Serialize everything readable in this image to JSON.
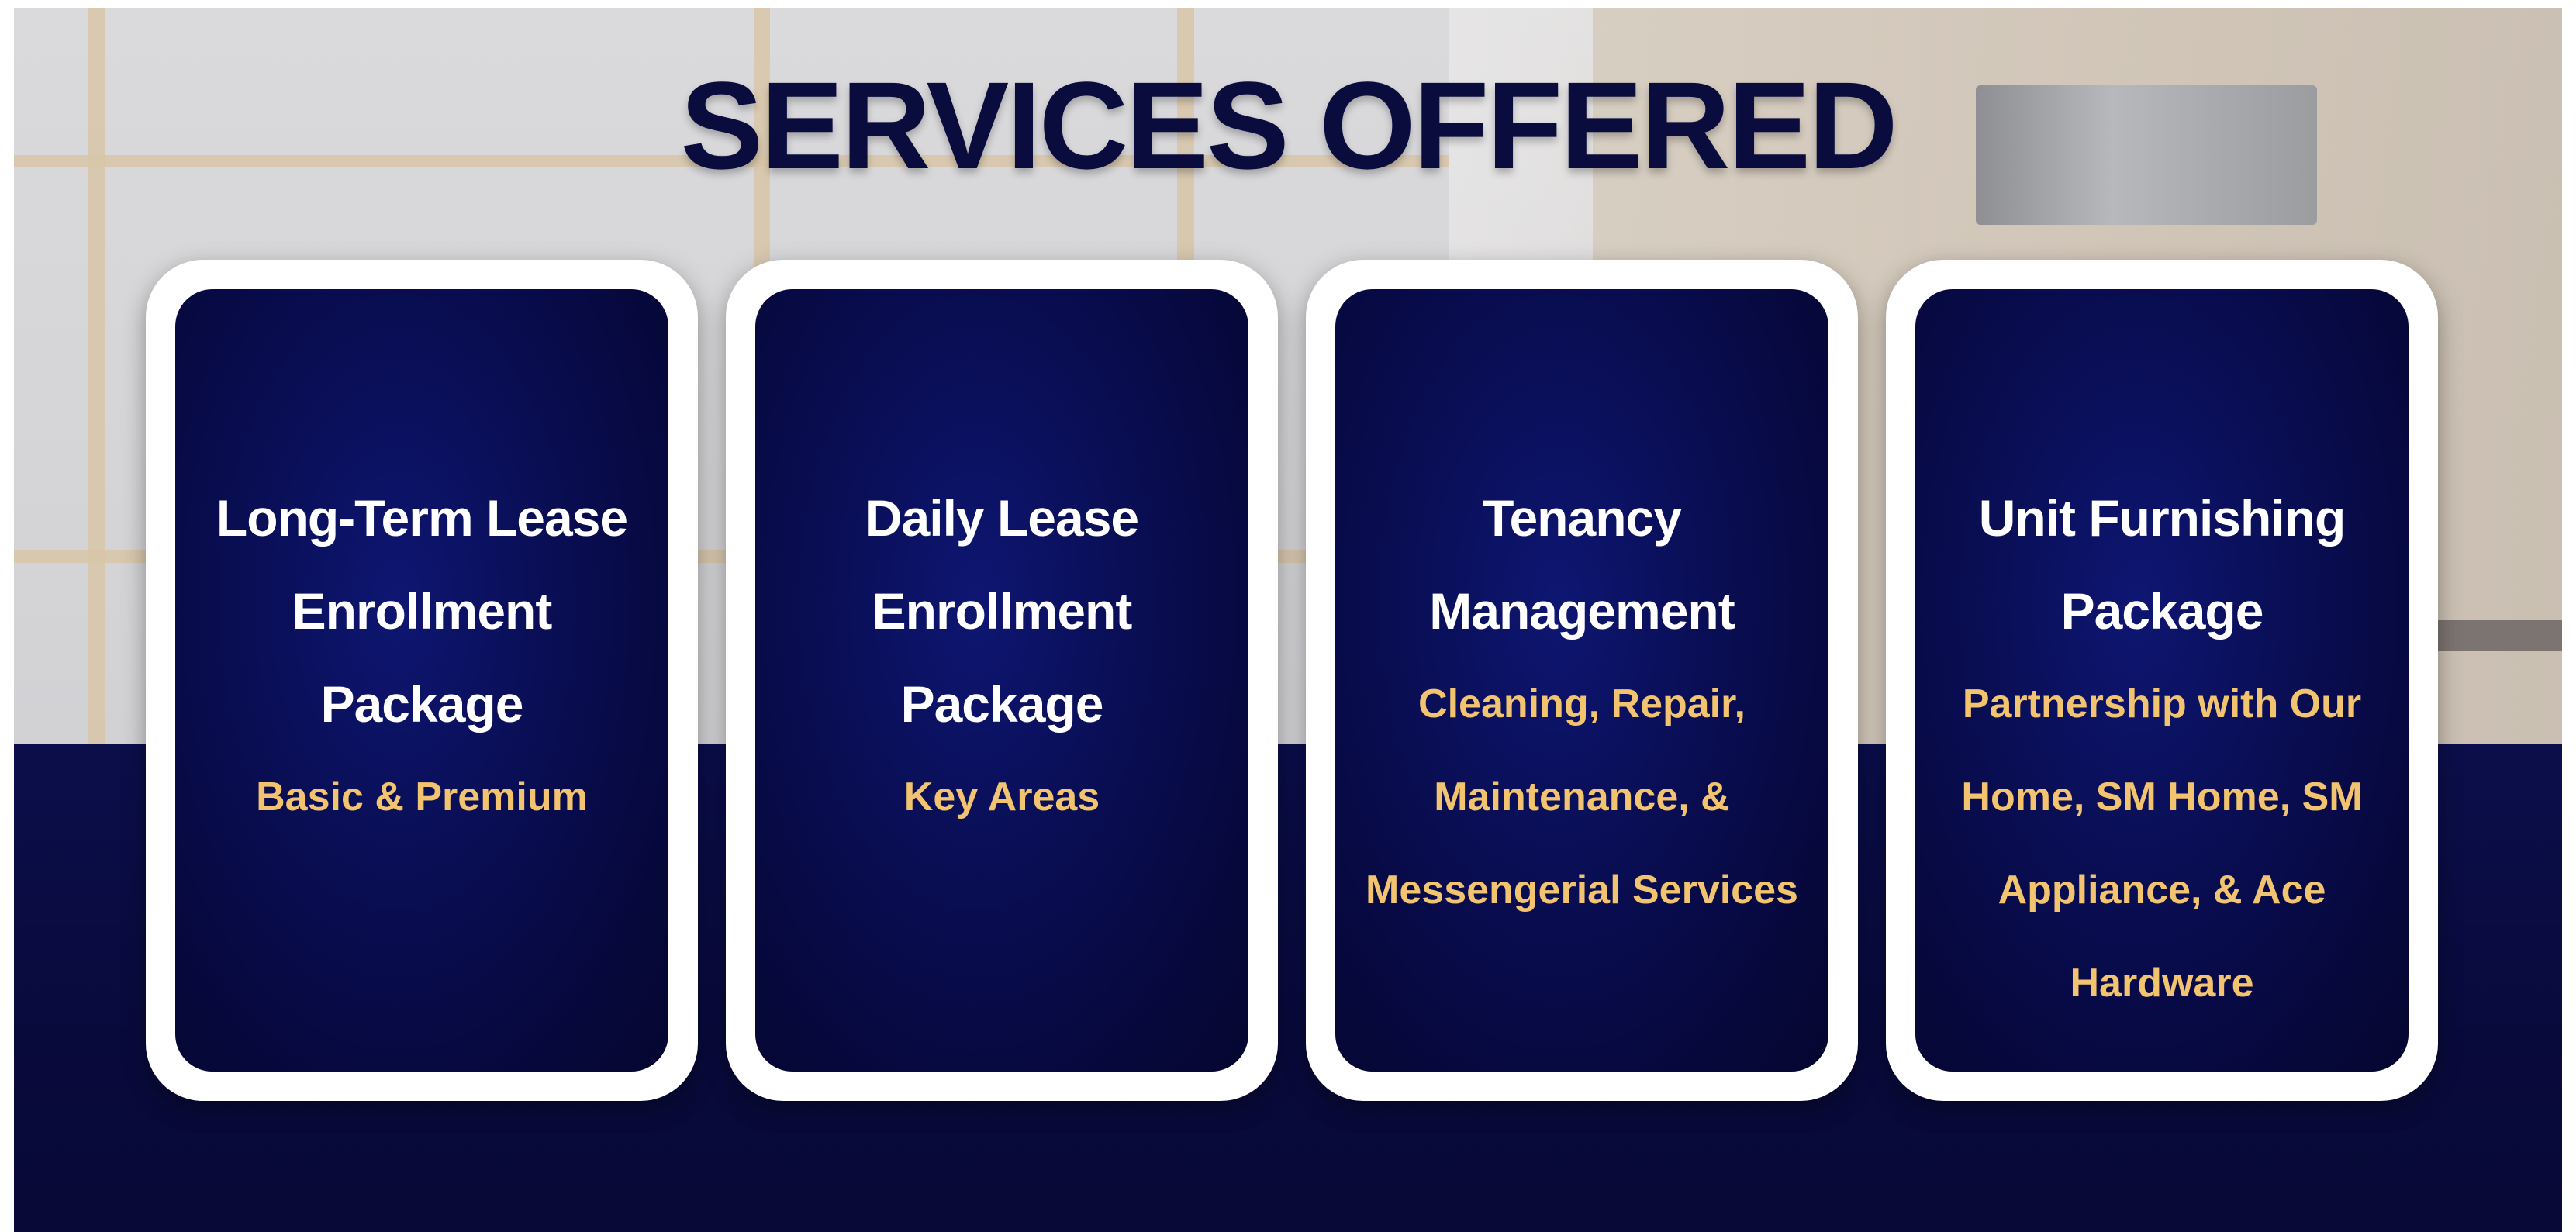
{
  "slide": {
    "title": "SERVICES OFFERED"
  },
  "services": [
    {
      "heading": "Long-Term Lease\nEnrollment\nPackage",
      "subtitle": "Basic & Premium"
    },
    {
      "heading": "Daily Lease\nEnrollment\nPackage",
      "subtitle": "Key  Areas"
    },
    {
      "heading": "Tenancy\nManagement",
      "subtitle": "Cleaning, Repair,\nMaintenance, &\nMessengerial Services"
    },
    {
      "heading": "Unit Furnishing\nPackage",
      "subtitle": "Partnership with Our\nHome, SM Home, SM\nAppliance, & Ace\nHardware"
    }
  ],
  "colors": {
    "title": "#0a0c3e",
    "card_background": "#0a0f58",
    "card_border": "#ffffff",
    "heading_text": "#ffffff",
    "subtitle_text": "#f2c46f",
    "bottom_band": "#0b0e4a"
  }
}
